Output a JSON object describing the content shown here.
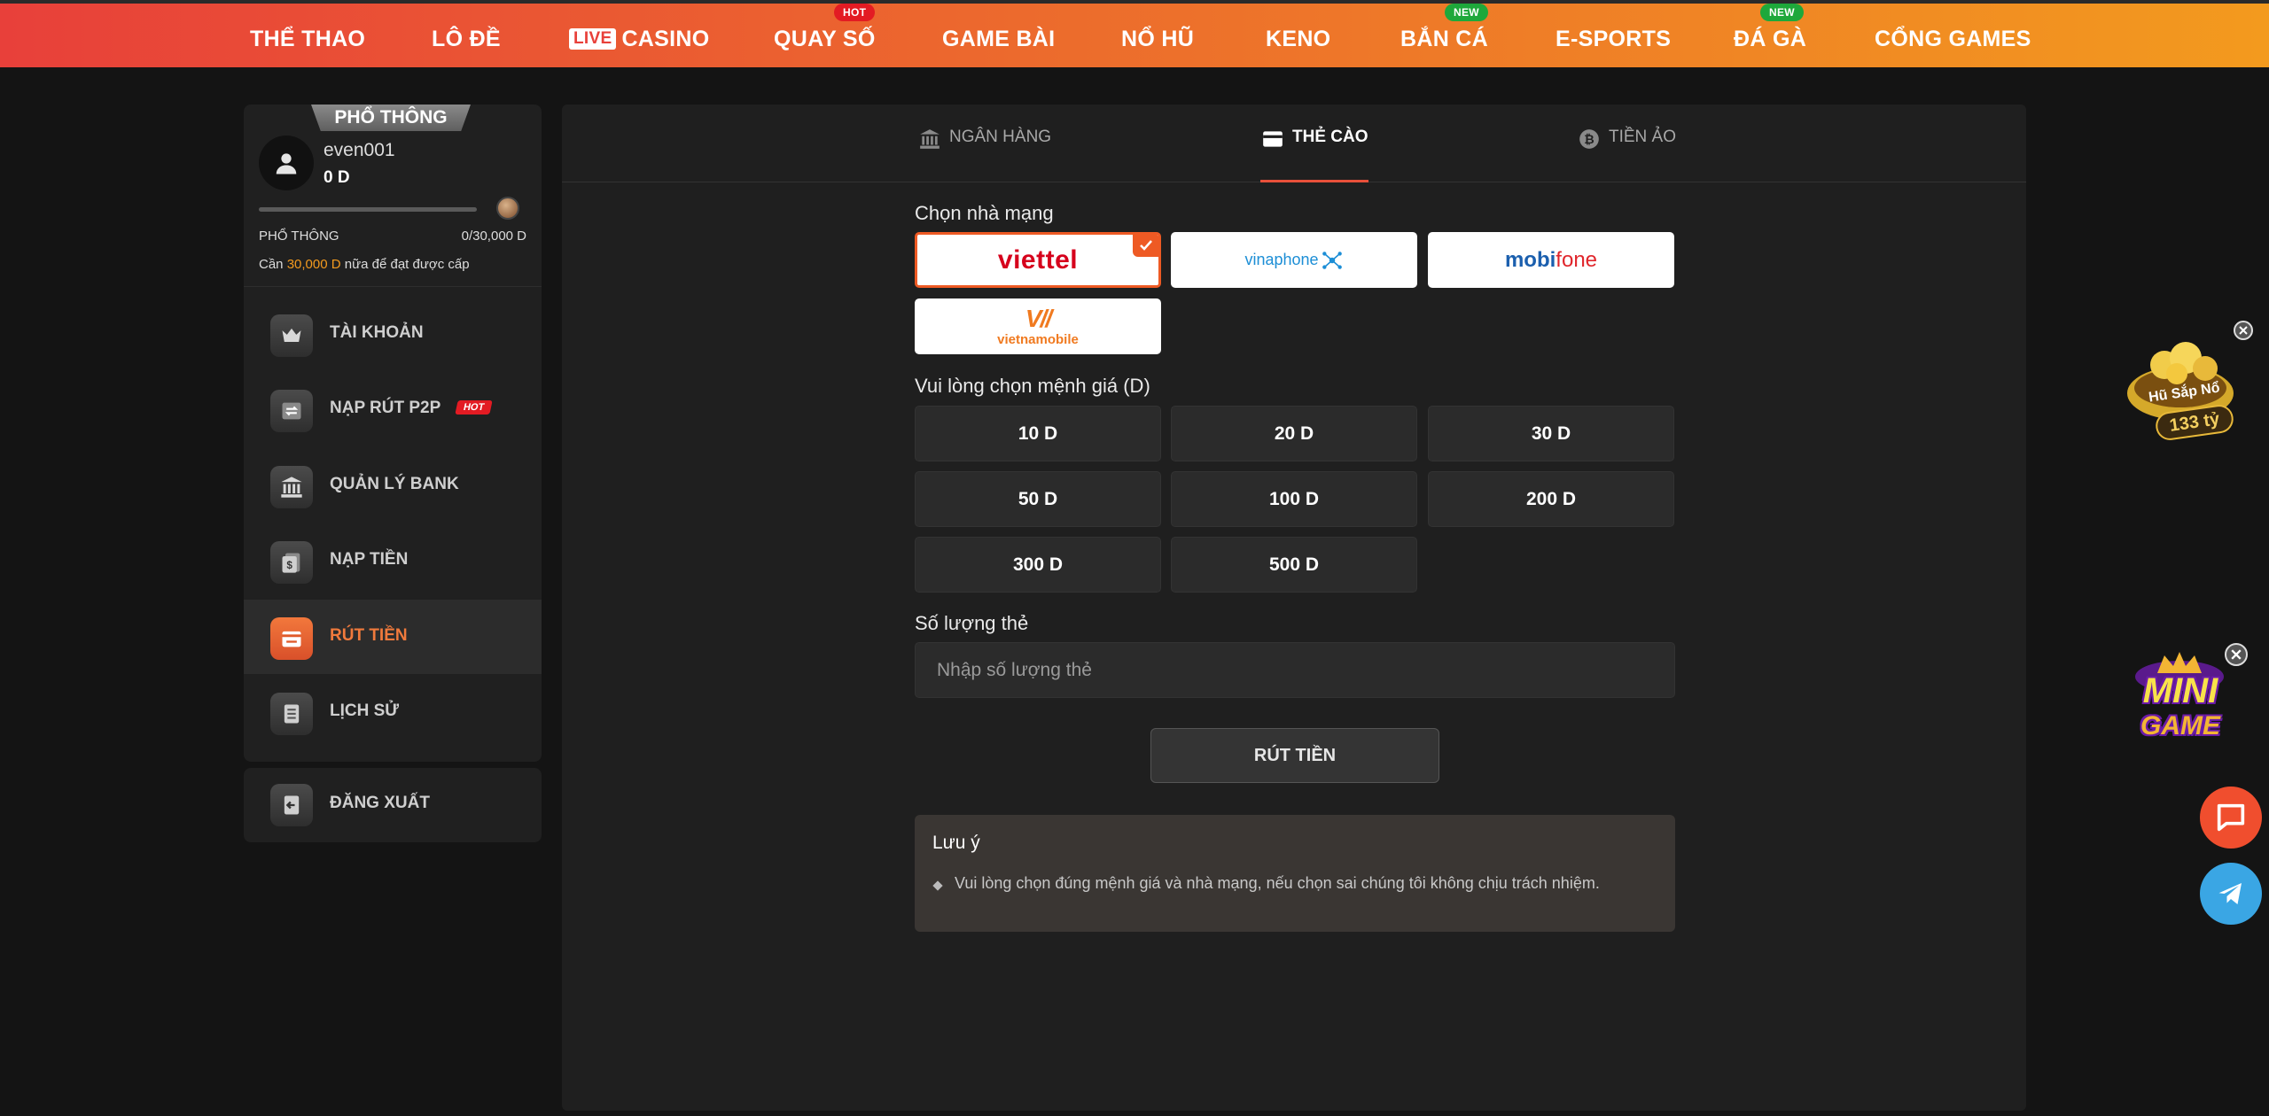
{
  "nav": {
    "items": [
      {
        "label": "THỂ THAO"
      },
      {
        "label": "LÔ ĐỀ"
      },
      {
        "label": "CASINO",
        "prefix": "LIVE"
      },
      {
        "label": "QUAY SỐ",
        "badge": "HOT"
      },
      {
        "label": "GAME BÀI"
      },
      {
        "label": "NỔ HŨ"
      },
      {
        "label": "KENO"
      },
      {
        "label": "BẮN CÁ",
        "badge": "NEW"
      },
      {
        "label": "E-SPORTS"
      },
      {
        "label": "ĐÁ GÀ",
        "badge": "NEW"
      },
      {
        "label": "CỔNG GAMES"
      }
    ]
  },
  "profile": {
    "tier_tab": "PHỔ THÔNG",
    "username": "even001",
    "balance": "0 D",
    "progress_fraction": 0.0,
    "tier_label": "PHỔ THÔNG",
    "tier_progress": "0/30,000 D",
    "need_prefix": "Cần ",
    "need_amount": "30,000 D",
    "need_suffix": " nữa để đạt được cấp"
  },
  "sidebar": {
    "items": [
      {
        "label": "TÀI KHOẢN",
        "icon": "crown-icon"
      },
      {
        "label": "NẠP RÚT P2P",
        "icon": "transfer-icon",
        "tag": "HOT"
      },
      {
        "label": "QUẢN LÝ BANK",
        "icon": "bank-icon"
      },
      {
        "label": "NẠP TIỀN",
        "icon": "money-icon"
      },
      {
        "label": "RÚT TIỀN",
        "icon": "withdraw-icon",
        "active": true
      },
      {
        "label": "LỊCH SỬ",
        "icon": "history-icon"
      }
    ],
    "logout_label": "ĐĂNG XUẤT"
  },
  "tabs": [
    {
      "label": "NGÂN HÀNG",
      "icon": "bank-icon"
    },
    {
      "label": "THẺ CÀO",
      "icon": "card-icon",
      "active": true
    },
    {
      "label": "TIỀN ẢO",
      "icon": "bitcoin-icon"
    }
  ],
  "form": {
    "carrier_label": "Chọn nhà mạng",
    "carriers": [
      {
        "name": "viettel",
        "selected": true
      },
      {
        "name": "vinaphone"
      },
      {
        "name": "mobifone"
      },
      {
        "name": "vietnamobile"
      }
    ],
    "mobi_a": "mobi",
    "mobi_b": "fone",
    "vnm_mark": "V//",
    "denom_label": "Vui lòng chọn mệnh giá (D)",
    "denominations": [
      "10 D",
      "20 D",
      "30 D",
      "50 D",
      "100 D",
      "200 D",
      "300 D",
      "500 D"
    ],
    "quantity_label": "Số lượng thẻ",
    "quantity_placeholder": "Nhập số lượng thẻ",
    "quantity_value": "",
    "submit_label": "RÚT TIỀN"
  },
  "note": {
    "title": "Lưu ý",
    "text": "Vui lòng chọn đúng mệnh giá và nhà mạng, nếu chọn sai chúng tôi không chịu trách nhiệm."
  },
  "floating": {
    "jackpot_title": "Hũ Sắp Nổ",
    "jackpot_value": "133 tỷ",
    "mini_a": "MINI",
    "mini_b": "GAME"
  },
  "colors": {
    "accent": "#ee5a24",
    "hot": "#e31b23",
    "new": "#1ea83b"
  }
}
